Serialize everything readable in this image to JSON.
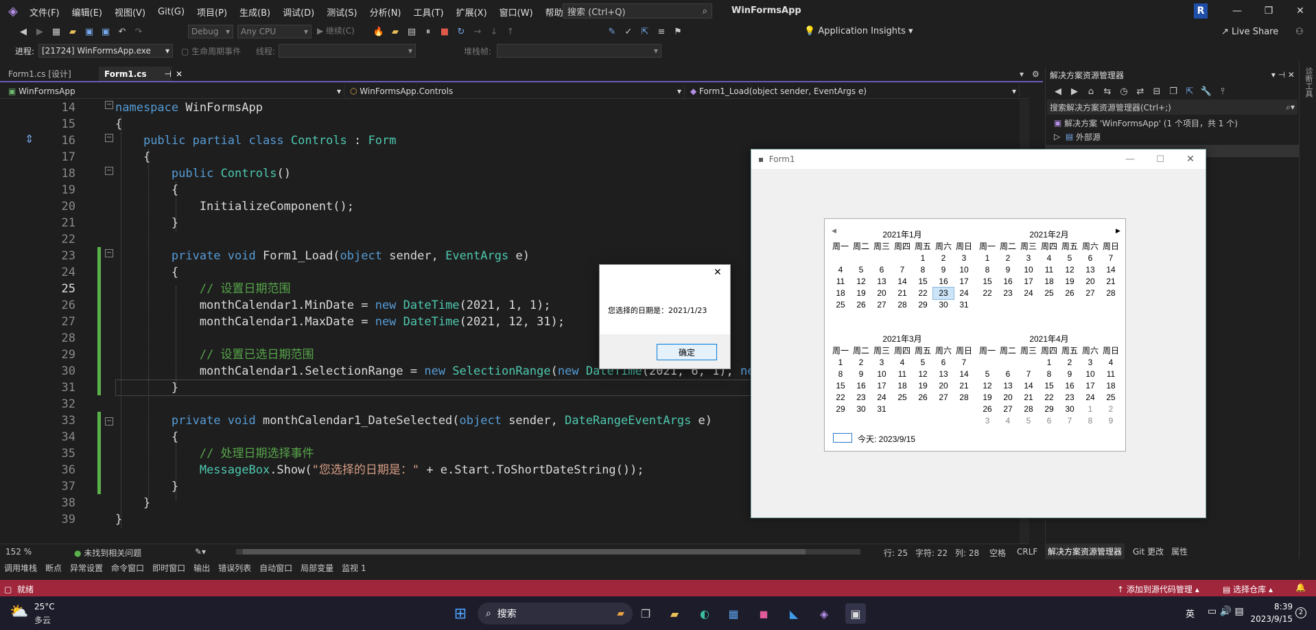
{
  "titlebar": {
    "menu": [
      "文件(F)",
      "编辑(E)",
      "视图(V)",
      "Git(G)",
      "项目(P)",
      "生成(B)",
      "调试(D)",
      "测试(S)",
      "分析(N)",
      "工具(T)",
      "扩展(X)",
      "窗口(W)",
      "帮助(H)"
    ],
    "search_placeholder": "搜索 (Ctrl+Q)",
    "app_name": "WinFormsApp",
    "avatar": "R"
  },
  "toolbar1": {
    "config": "Debug",
    "platform": "Any CPU",
    "continue_label": "继续(C)",
    "insights": "Application Insights",
    "live_share": "Live Share"
  },
  "toolbar2": {
    "process_label": "进程:",
    "process_value": "[21724] WinFormsApp.exe",
    "lifecycle_label": "生命周期事件",
    "thread_label": "线程:",
    "stackframe_label": "堆栈帧:"
  },
  "doc_tabs": [
    {
      "label": "Form1.cs [设计]"
    },
    {
      "label": "Form1.cs"
    }
  ],
  "navbar": {
    "project": "WinFormsApp",
    "class": "WinFormsApp.Controls",
    "member": "Form1_Load(object sender, EventArgs e)"
  },
  "code": {
    "line_numbers": [
      "14",
      "15",
      "16",
      "17",
      "18",
      "19",
      "20",
      "21",
      "22",
      "23",
      "24",
      "25",
      "26",
      "27",
      "28",
      "29",
      "30",
      "31",
      "32",
      "33",
      "34",
      "35",
      "36",
      "37",
      "38",
      "39"
    ],
    "current_line": "25"
  },
  "editor_status": {
    "zoom": "152 %",
    "issues": "未找到相关问题",
    "line": "行: 25",
    "char": "字符: 22",
    "col": "列: 28",
    "spaces": "空格",
    "eol": "CRLF"
  },
  "solution_explorer": {
    "title": "解决方案资源管理器",
    "search": "搜索解决方案资源管理器(Ctrl+;)",
    "solution_item": "解决方案 'WinFormsApp' (1 个项目，共 1 个)",
    "external_item": "外部源",
    "tabs": [
      "解决方案资源管理器",
      "Git 更改",
      "属性"
    ]
  },
  "right_strip_label": "诊断工具",
  "tool_tabs": [
    "调用堆栈",
    "断点",
    "异常设置",
    "命令窗口",
    "即时窗口",
    "输出",
    "错误列表",
    "自动窗口",
    "局部变量",
    "监视 1"
  ],
  "statusbar": {
    "ready": "就绪",
    "add_source": "添加到源代码管理",
    "select_repo": "选择仓库"
  },
  "taskbar": {
    "weather_temp": "25°C",
    "weather_desc": "多云",
    "search": "搜索",
    "lang": "英",
    "time": "8:39",
    "date": "2023/9/15",
    "notif": "2"
  },
  "form": {
    "title": "Form1",
    "today_label": "今天: 2023/9/15",
    "day_names": [
      "周一",
      "周二",
      "周三",
      "周四",
      "周五",
      "周六",
      "周日"
    ],
    "months": [
      {
        "title": "2021年1月",
        "weeks": [
          [
            "",
            "",
            "",
            "",
            "1",
            "2",
            "3"
          ],
          [
            "4",
            "5",
            "6",
            "7",
            "8",
            "9",
            "10"
          ],
          [
            "11",
            "12",
            "13",
            "14",
            "15",
            "16",
            "17"
          ],
          [
            "18",
            "19",
            "20",
            "21",
            "22",
            "23",
            "24"
          ],
          [
            "25",
            "26",
            "27",
            "28",
            "29",
            "30",
            "31"
          ]
        ],
        "selected": "23"
      },
      {
        "title": "2021年2月",
        "weeks": [
          [
            "1",
            "2",
            "3",
            "4",
            "5",
            "6",
            "7"
          ],
          [
            "8",
            "9",
            "10",
            "11",
            "12",
            "13",
            "14"
          ],
          [
            "15",
            "16",
            "17",
            "18",
            "19",
            "20",
            "21"
          ],
          [
            "22",
            "23",
            "24",
            "25",
            "26",
            "27",
            "28"
          ]
        ]
      },
      {
        "title": "2021年3月",
        "weeks": [
          [
            "1",
            "2",
            "3",
            "4",
            "5",
            "6",
            "7"
          ],
          [
            "8",
            "9",
            "10",
            "11",
            "12",
            "13",
            "14"
          ],
          [
            "15",
            "16",
            "17",
            "18",
            "19",
            "20",
            "21"
          ],
          [
            "22",
            "23",
            "24",
            "25",
            "26",
            "27",
            "28"
          ],
          [
            "29",
            "30",
            "31",
            "",
            "",
            "",
            ""
          ]
        ]
      },
      {
        "title": "2021年4月",
        "weeks": [
          [
            "",
            "",
            "",
            "1",
            "2",
            "3",
            "4"
          ],
          [
            "5",
            "6",
            "7",
            "8",
            "9",
            "10",
            "11"
          ],
          [
            "12",
            "13",
            "14",
            "15",
            "16",
            "17",
            "18"
          ],
          [
            "19",
            "20",
            "21",
            "22",
            "23",
            "24",
            "25"
          ],
          [
            "26",
            "27",
            "28",
            "29",
            "30",
            "1",
            "2"
          ],
          [
            "3",
            "4",
            "5",
            "6",
            "7",
            "8",
            "9"
          ]
        ],
        "gray_from_week": 4,
        "gray_from_col": 5
      }
    ]
  },
  "msgbox": {
    "text": "您选择的日期是：2021/1/23",
    "ok_label": "确定"
  }
}
